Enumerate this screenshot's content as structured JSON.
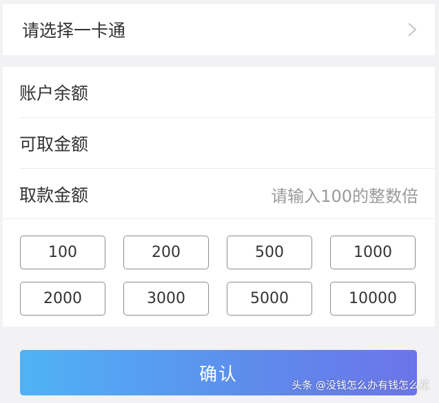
{
  "card_select": {
    "label": "请选择一卡通",
    "chevron_icon": "chevron-right-icon"
  },
  "form": {
    "balance_label": "账户余额",
    "available_label": "可取金额",
    "withdraw_label": "取款金额",
    "withdraw_placeholder": "请输入100的整数倍"
  },
  "amounts": [
    "100",
    "200",
    "500",
    "1000",
    "2000",
    "3000",
    "5000",
    "10000"
  ],
  "confirm_label": "确认",
  "watermark": "头条 @没钱怎么办有钱怎么花",
  "colors": {
    "background": "#f2f2f4",
    "button_gradient_start": "#4fb3f6",
    "button_gradient_end": "#6c74e9"
  }
}
